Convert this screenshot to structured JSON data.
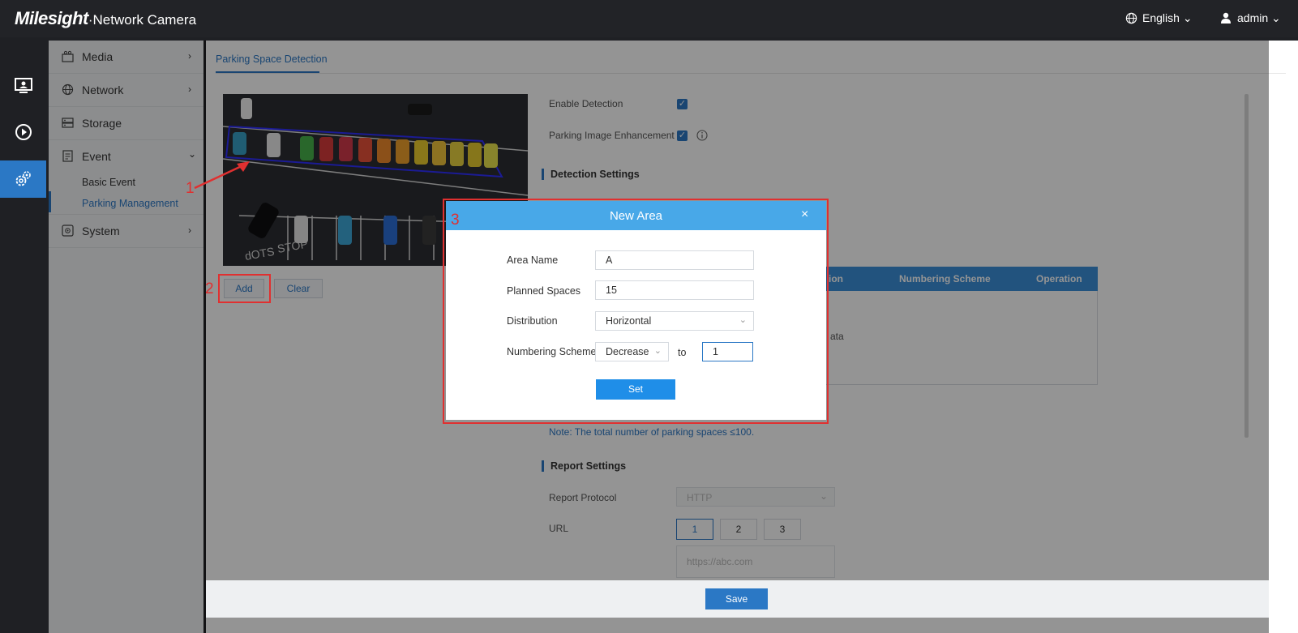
{
  "header": {
    "brand": "Milesight",
    "product": "·Network Camera",
    "language": "English",
    "user": "admin"
  },
  "rail": {
    "icons": [
      "monitor-icon",
      "playback-icon",
      "settings-icon"
    ]
  },
  "sidebar": {
    "items": [
      {
        "label": "Media",
        "icon": "media-icon",
        "chevron": "›"
      },
      {
        "label": "Network",
        "icon": "globe-icon",
        "chevron": "›"
      },
      {
        "label": "Storage",
        "icon": "storage-icon",
        "chevron": ""
      },
      {
        "label": "Event",
        "icon": "event-icon",
        "chevron": "⌄"
      },
      {
        "label": "System",
        "icon": "system-icon",
        "chevron": "›"
      }
    ],
    "subitems": [
      "Basic Event",
      "Parking Management"
    ]
  },
  "main": {
    "tab": "Parking Space Detection",
    "add_label": "Add",
    "clear_label": "Clear",
    "enable_detection": "Enable Detection",
    "parking_enhancement": "Parking Image Enhancement",
    "detection_settings": "Detection Settings",
    "table_headers": [
      "ion",
      "Numbering Scheme",
      "Operation"
    ],
    "table_fragment": "ata",
    "note": "Note: The total number of parking spaces ≤100.",
    "report_settings": "Report Settings",
    "report_protocol_label": "Report Protocol",
    "report_protocol_value": "HTTP",
    "url_label": "URL",
    "url_buttons": [
      "1",
      "2",
      "3"
    ],
    "url_placeholder": "https://abc.com",
    "save_label": "Save"
  },
  "dialog": {
    "title": "New Area",
    "close": "×",
    "area_name_label": "Area Name",
    "area_name_value": "A",
    "planned_spaces_label": "Planned Spaces",
    "planned_spaces_value": "15",
    "distribution_label": "Distribution",
    "distribution_value": "Horizontal",
    "numbering_label": "Numbering Scheme",
    "numbering_value": "Decrease",
    "to_label": "to",
    "to_value": "1",
    "set_label": "Set"
  },
  "annotations": [
    "1",
    "2",
    "3"
  ],
  "colors": {
    "accent": "#2b78c5",
    "dialog_header": "#48a8e8",
    "annotation": "#e03030"
  }
}
